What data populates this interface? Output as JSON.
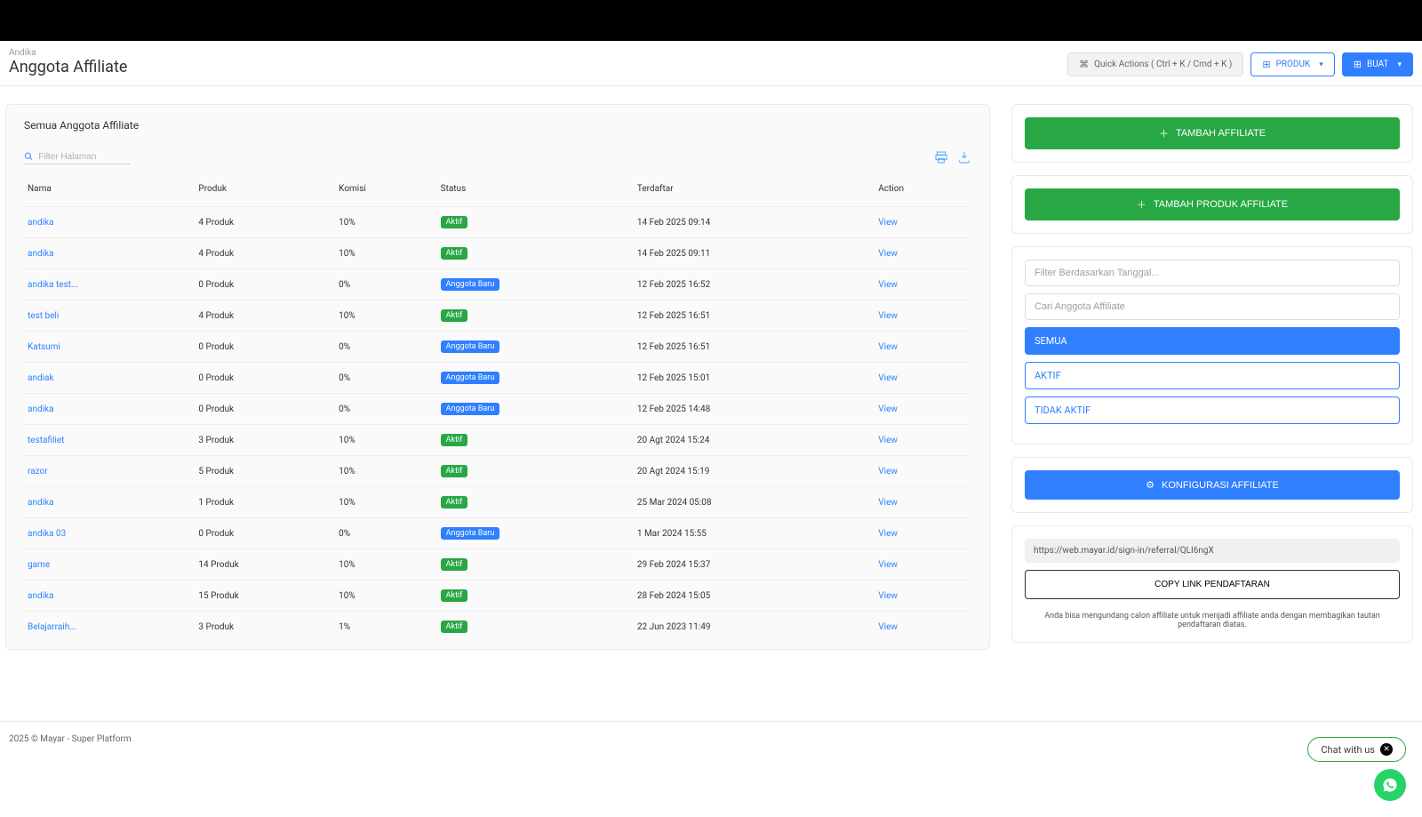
{
  "header": {
    "breadcrumb": "Andika",
    "title": "Anggota Affiliate",
    "quick_actions": "Quick Actions ( Ctrl + K / Cmd + K )",
    "produk_btn": "PRODUK",
    "buat_btn": "BUAT"
  },
  "panel": {
    "title": "Semua Anggota Affiliate",
    "filter_placeholder": "Filter Halaman"
  },
  "columns": {
    "nama": "Nama",
    "produk": "Produk",
    "komisi": "Komisi",
    "status": "Status",
    "terdaftar": "Terdaftar",
    "action": "Action"
  },
  "status_labels": {
    "aktif": "Aktif",
    "anggota_baru": "Anggota Baru"
  },
  "action_view": "View",
  "rows": [
    {
      "nama": "andika",
      "produk": "4 Produk",
      "komisi": "10%",
      "status": "aktif",
      "terdaftar": "14 Feb 2025 09:14"
    },
    {
      "nama": "andika",
      "produk": "4 Produk",
      "komisi": "10%",
      "status": "aktif",
      "terdaftar": "14 Feb 2025 09:11"
    },
    {
      "nama": "andika test...",
      "produk": "0 Produk",
      "komisi": "0%",
      "status": "anggota_baru",
      "terdaftar": "12 Feb 2025 16:52"
    },
    {
      "nama": "test beli",
      "produk": "4 Produk",
      "komisi": "10%",
      "status": "aktif",
      "terdaftar": "12 Feb 2025 16:51"
    },
    {
      "nama": "Katsumi",
      "produk": "0 Produk",
      "komisi": "0%",
      "status": "anggota_baru",
      "terdaftar": "12 Feb 2025 16:51"
    },
    {
      "nama": "andiak",
      "produk": "0 Produk",
      "komisi": "0%",
      "status": "anggota_baru",
      "terdaftar": "12 Feb 2025 15:01"
    },
    {
      "nama": "andika",
      "produk": "0 Produk",
      "komisi": "0%",
      "status": "anggota_baru",
      "terdaftar": "12 Feb 2025 14:48"
    },
    {
      "nama": "testafiliet",
      "produk": "3 Produk",
      "komisi": "10%",
      "status": "aktif",
      "terdaftar": "20 Agt 2024 15:24"
    },
    {
      "nama": "razor",
      "produk": "5 Produk",
      "komisi": "10%",
      "status": "aktif",
      "terdaftar": "20 Agt 2024 15:19"
    },
    {
      "nama": "andika",
      "produk": "1 Produk",
      "komisi": "10%",
      "status": "aktif",
      "terdaftar": "25 Mar 2024 05:08"
    },
    {
      "nama": "andika 03",
      "produk": "0 Produk",
      "komisi": "0%",
      "status": "anggota_baru",
      "terdaftar": "1 Mar 2024 15:55"
    },
    {
      "nama": "game",
      "produk": "14 Produk",
      "komisi": "10%",
      "status": "aktif",
      "terdaftar": "29 Feb 2024 15:37"
    },
    {
      "nama": "andika",
      "produk": "15 Produk",
      "komisi": "10%",
      "status": "aktif",
      "terdaftar": "28 Feb 2024 15:05"
    },
    {
      "nama": "Belajarraih...",
      "produk": "3 Produk",
      "komisi": "1%",
      "status": "aktif",
      "terdaftar": "22 Jun 2023 11:49"
    }
  ],
  "side": {
    "tambah_affiliate": "TAMBAH AFFILIATE",
    "tambah_produk": "TAMBAH PRODUK AFFILIATE",
    "filter_tanggal_placeholder": "Filter Berdasarkan Tanggal...",
    "cari_placeholder": "Cari Anggota Affiliate",
    "filters": {
      "semua": "SEMUA",
      "aktif": "AKTIF",
      "tidak_aktif": "TIDAK AKTIF"
    },
    "konfigurasi": "KONFIGURASI AFFILIATE",
    "referral_link": "https://web.mayar.id/sign-in/referral/QLI6ngX",
    "copy_link": "COPY LINK PENDAFTARAN",
    "invite_text": "Anda bisa mengundang calon affiliate untuk menjadi affiliate anda dengan membagikan tautan pendaftaran diatas."
  },
  "footer": {
    "text": "2025 © Mayar - Super Platform"
  },
  "chat": {
    "label": "Chat with us"
  }
}
